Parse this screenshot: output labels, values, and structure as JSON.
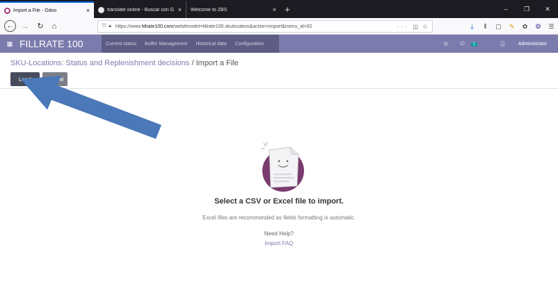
{
  "browser": {
    "tabs": [
      {
        "title": "Import a File - Odoo",
        "close": "×",
        "active": true
      },
      {
        "title": "translate online - Buscar con G",
        "close": "×",
        "active": false
      },
      {
        "title": "Welcome to ZBS",
        "close": "×",
        "active": false
      }
    ],
    "new_tab": "+",
    "window_controls": [
      "–",
      "❐",
      "✕"
    ],
    "url_prefix": "https://www.",
    "url_domain": "fillrate100.com",
    "url_rest": "/web#model=fillrate100.skulocation&action=import&menu_id=82",
    "url_menu": "···",
    "accent": "#0060df"
  },
  "odoo": {
    "brand": "FILLRATE 100",
    "bar_color": "#7c7bad",
    "menus": [
      {
        "label": "Current status"
      },
      {
        "label": "Buffer Management"
      },
      {
        "label": "Historical data"
      },
      {
        "label": "Configuration"
      }
    ],
    "chat_count": "1",
    "user": "Administrator"
  },
  "control": {
    "breadcrumb_link": "SKU-Locations: Status and Replenishment decisions",
    "breadcrumb_sep": " / ",
    "breadcrumb_current": "Import a File",
    "load_label": "Load",
    "cancel_label": "Cancel"
  },
  "main": {
    "headline": "Select a CSV or Excel file to import.",
    "subtext": "Excel files are recommended as fields formatting is automatic.",
    "help_label": "Need Help?",
    "faq_link": "Import FAQ"
  },
  "annotation": {
    "arrow_color": "#4a78b8"
  }
}
